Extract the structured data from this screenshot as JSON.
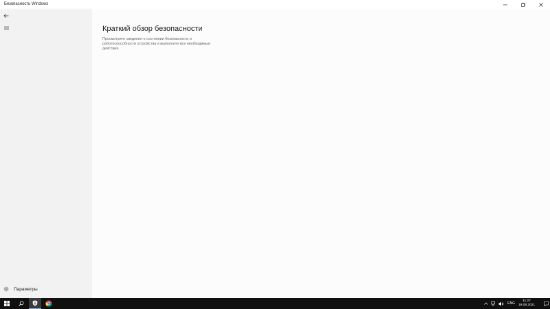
{
  "window": {
    "title": "Безопасность Windows",
    "controls": {
      "minimize": "–",
      "maximize": "❐",
      "close": "✕"
    }
  },
  "sidebar": {
    "back_icon": "back-arrow-icon",
    "menu_icon": "hamburger-icon",
    "settings_label": "Параметры",
    "settings_icon": "gear-icon"
  },
  "main": {
    "title": "Краткий обзор безопасности",
    "description": "Просмотрите сведения о состоянии безопасности и работоспособности устройства и выполните все необходимые действия."
  },
  "taskbar": {
    "items": [
      "windows-start-icon",
      "search-icon",
      "windows-security-shield-icon",
      "chrome-icon"
    ],
    "tray": {
      "language": "ENG",
      "time": "11:27",
      "date": "19.08.2021"
    }
  },
  "colors": {
    "sidebar_bg": "#f2f2f2",
    "main_bg": "#fcfcfc",
    "taskbar_bg": "#101010",
    "active_task_underline": "#8fb6e8"
  }
}
